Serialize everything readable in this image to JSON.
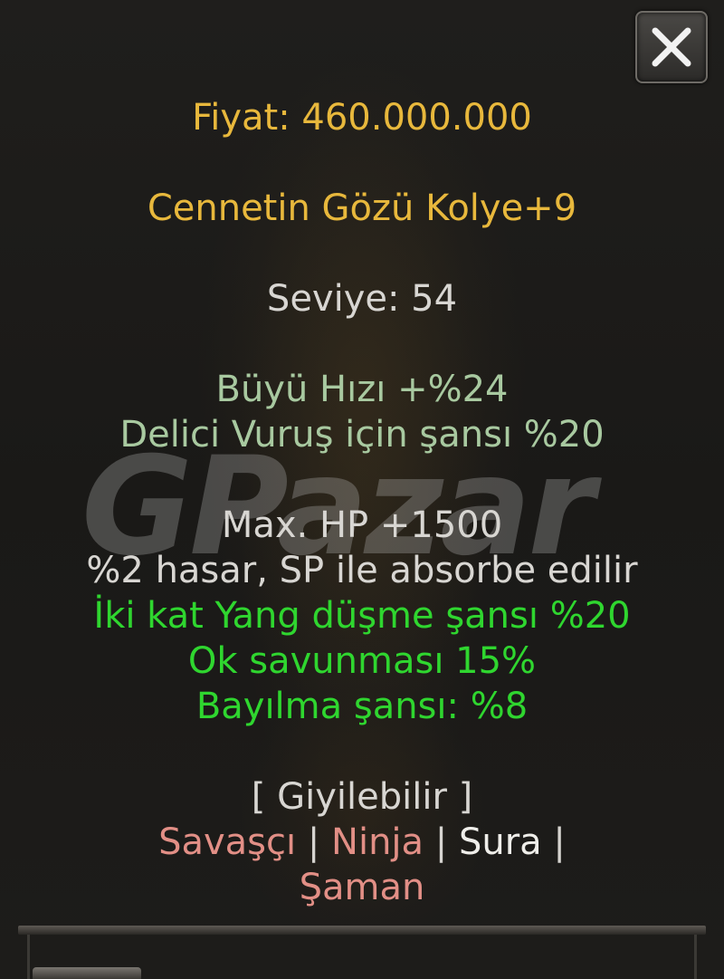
{
  "close_button": {
    "icon": "close-icon"
  },
  "item": {
    "price": "Fiyat: 460.000.000",
    "name": "Cennetin Gözü Kolye+9",
    "level": "Seviye: 54"
  },
  "base_bonuses": [
    "Büyü Hızı +%24",
    "Delici Vuruş için şansı %20"
  ],
  "bonuses": [
    {
      "text": "Max. HP +1500",
      "color": "#d8d6d2"
    },
    {
      "text": "%2 hasar, SP ile absorbe edilir",
      "color": "#d8d6d2"
    },
    {
      "text": "İki kat Yang düşme şansı %20",
      "color": "#2fd62f"
    },
    {
      "text": "Ok savunması 15%",
      "color": "#2fd62f"
    },
    {
      "text": "Bayılma şansı: %8",
      "color": "#2fd62f"
    }
  ],
  "wearable": {
    "label": "[ Giyilebilir ]",
    "classes": {
      "savasci": "Savaşçı",
      "ninja": "Ninja",
      "sura": "Sura",
      "saman": "Şaman",
      "separator": "|"
    }
  },
  "watermark": "GPazar",
  "colors": {
    "gold": "#e8b83c",
    "pale_green": "#a8c9a0",
    "bright_green": "#2fd62f",
    "class_unavailable": "#e28f86",
    "class_available": "#efeeea"
  }
}
